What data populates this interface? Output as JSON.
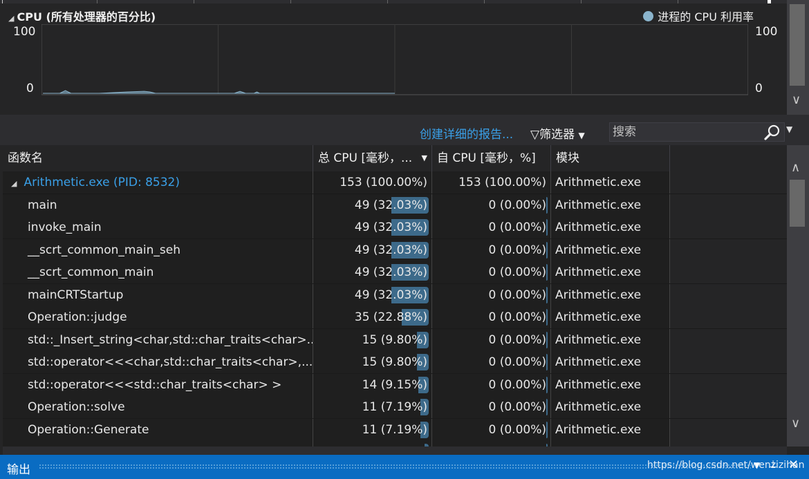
{
  "graph": {
    "title": "CPU (所有处理器的百分比)",
    "legend": "进程的 CPU 利用率",
    "y_max": "100",
    "y_min": "0",
    "series_color": "#8ab4cc"
  },
  "chart_data": {
    "type": "area",
    "title": "CPU (所有处理器的百分比)",
    "legend": [
      "进程的 CPU 利用率"
    ],
    "ylim": [
      0,
      100
    ],
    "grid": true,
    "series": [
      {
        "name": "进程的 CPU 利用率",
        "x": [
          0,
          6,
          8,
          10,
          20,
          30,
          36,
          38,
          40,
          60,
          68,
          70,
          72,
          75,
          76,
          77,
          80,
          100,
          125
        ],
        "values": [
          0,
          0,
          4,
          0,
          0,
          2,
          3,
          2,
          0,
          0,
          0,
          3,
          0,
          0,
          2,
          0,
          0,
          0,
          0
        ]
      }
    ]
  },
  "toolbar": {
    "report_label": "创建详细的报告...",
    "filter_label": "筛选器",
    "search_placeholder": "搜索"
  },
  "table": {
    "columns": [
      "函数名",
      "总 CPU [毫秒，...",
      "自 CPU [毫秒，%]",
      "模块"
    ],
    "root": {
      "name": "Arithmetic.exe (PID: 8532)",
      "total": "153 (100.00%)",
      "self": "153 (100.00%)",
      "module": "Arithmetic.exe"
    },
    "rows": [
      {
        "name": "main",
        "total": "49 (32.03%)",
        "pct": 32.03,
        "self": "0 (0.00%)",
        "module": "Arithmetic.exe"
      },
      {
        "name": "invoke_main",
        "total": "49 (32.03%)",
        "pct": 32.03,
        "self": "0 (0.00%)",
        "module": "Arithmetic.exe"
      },
      {
        "name": "__scrt_common_main_seh",
        "total": "49 (32.03%)",
        "pct": 32.03,
        "self": "0 (0.00%)",
        "module": "Arithmetic.exe"
      },
      {
        "name": "__scrt_common_main",
        "total": "49 (32.03%)",
        "pct": 32.03,
        "self": "0 (0.00%)",
        "module": "Arithmetic.exe"
      },
      {
        "name": "mainCRTStartup",
        "total": "49 (32.03%)",
        "pct": 32.03,
        "self": "0 (0.00%)",
        "module": "Arithmetic.exe"
      },
      {
        "name": "Operation::judge",
        "total": "35 (22.88%)",
        "pct": 22.88,
        "self": "0 (0.00%)",
        "module": "Arithmetic.exe"
      },
      {
        "name": "std::_Insert_string<char,std::char_traits<char>...",
        "total": "15 (9.80%)",
        "pct": 9.8,
        "self": "0 (0.00%)",
        "module": "Arithmetic.exe"
      },
      {
        "name": "std::operator<<<char,std::char_traits<char>,...",
        "total": "15 (9.80%)",
        "pct": 9.8,
        "self": "0 (0.00%)",
        "module": "Arithmetic.exe"
      },
      {
        "name": "std::operator<<<std::char_traits<char> >",
        "total": "14 (9.15%)",
        "pct": 9.15,
        "self": "0 (0.00%)",
        "module": "Arithmetic.exe"
      },
      {
        "name": "Operation::solve",
        "total": "11 (7.19%)",
        "pct": 7.19,
        "self": "0 (0.00%)",
        "module": "Arithmetic.exe"
      },
      {
        "name": "Operation::Generate",
        "total": "11 (7.19%)",
        "pct": 7.19,
        "self": "0 (0.00%)",
        "module": "Arithmetic.exe"
      },
      {
        "name": "",
        "total": "",
        "pct": 3.27,
        "self": "",
        "module": ""
      }
    ]
  },
  "output": {
    "label": "输出",
    "watermark": "https://blog.csdn.net/wenzizihan"
  }
}
